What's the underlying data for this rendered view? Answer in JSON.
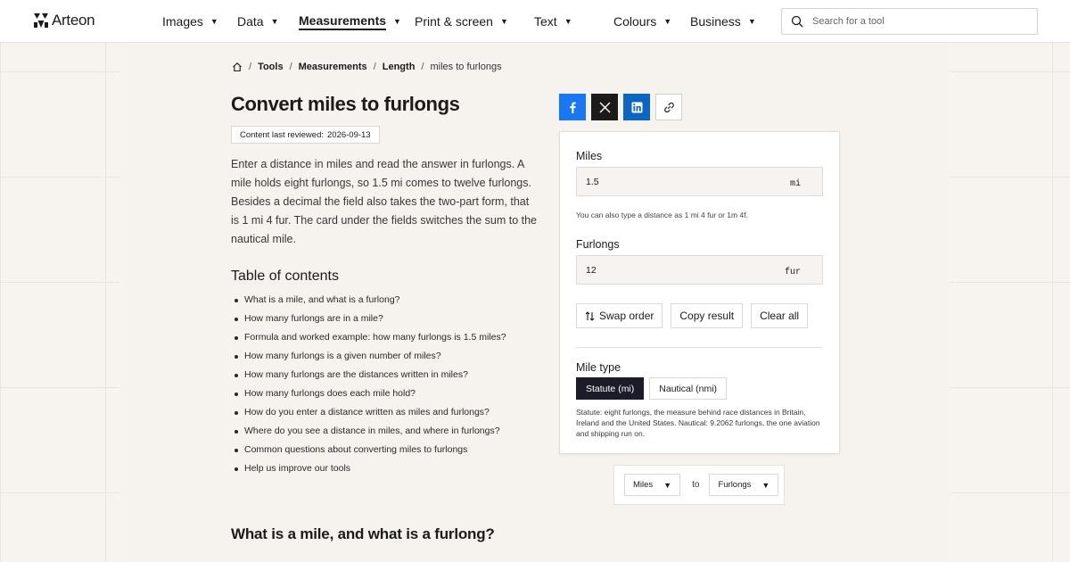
{
  "brand": {
    "name": "Arteon"
  },
  "nav": [
    {
      "label": "Images",
      "active": false
    },
    {
      "label": "Data",
      "active": false
    },
    {
      "label": "Measurements",
      "active": true
    },
    {
      "label": "Print & screen",
      "active": false
    },
    {
      "label": "Text",
      "active": false
    },
    {
      "label": "Colours",
      "active": false
    },
    {
      "label": "Business",
      "active": false
    }
  ],
  "search": {
    "placeholder": "Search for a tool",
    "icon": "search-icon"
  },
  "breadcrumb": {
    "home_icon": "home-icon",
    "items": [
      "Tools",
      "Measurements",
      "Length"
    ],
    "current": "miles to furlongs"
  },
  "page": {
    "title": "Convert miles to furlongs",
    "reviewed_label": "Content last reviewed:",
    "reviewed_date": "2026-09-13",
    "intro": "Enter a distance in miles and read the answer in furlongs. A mile holds eight furlongs, so 1.5 mi comes to twelve furlongs. Besides a decimal the field also takes the two-part form, that is 1 mi 4 fur. The card under the fields switches the sum to the nautical mile.",
    "toc_title": "Table of contents",
    "toc": [
      "What is a mile, and what is a furlong?",
      "How many furlongs are in a mile?",
      "Formula and worked example: how many furlongs is 1.5 miles?",
      "How many furlongs is a given number of miles?",
      "How many furlongs are the distances written in miles?",
      "How many furlongs does each mile hold?",
      "How do you enter a distance written as miles and furlongs?",
      "Where do you see a distance in miles, and where in furlongs?",
      "Common questions about converting miles to furlongs",
      "Help us improve our tools"
    ],
    "section_heading": "What is a mile, and what is a furlong?"
  },
  "share": {
    "icons": [
      "facebook-icon",
      "x-icon",
      "linkedin-icon",
      "link-icon"
    ],
    "colors": {
      "facebook": "#1877f2",
      "x": "#1c1b1a",
      "linkedin": "#0a66c2"
    }
  },
  "converter": {
    "from_label": "Miles",
    "from_value": "1.5",
    "from_unit": "mi",
    "hint": "You can also type a distance as 1 mi 4 fur or 1m 4f.",
    "to_label": "Furlongs",
    "to_value": "12",
    "to_unit": "fur",
    "actions": {
      "swap": "Swap order",
      "copy": "Copy result",
      "clear": "Clear all"
    },
    "mile_type_label": "Mile type",
    "mile_types": [
      {
        "label": "Statute (mi)",
        "selected": true
      },
      {
        "label": "Nautical (nmi)",
        "selected": false
      }
    ],
    "mile_note": "Statute: eight furlongs, the measure behind race distances in Britain, Ireland and the United States. Nautical: 9.2062 furlongs, the one aviation and shipping run on."
  },
  "pair": {
    "from": "Miles",
    "to_label": "to",
    "to": "Furlongs"
  }
}
